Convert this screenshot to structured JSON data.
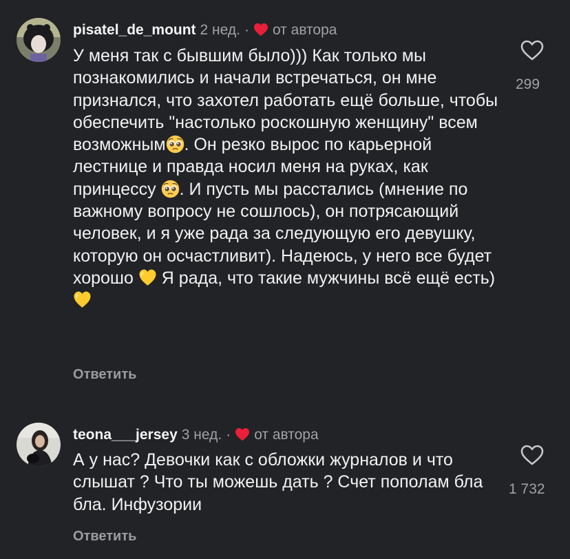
{
  "comments": [
    {
      "username": "pisatel_de_mount",
      "time": "2 нед.",
      "separator": "·",
      "author_label": "от автора",
      "text_parts": [
        "У меня так с бывшим было))) Как только мы познакомились и начали встречаться, он мне признался, что захотел работать ещё больше, чтобы обеспечить \"настолько роскошную женщину\" всем возможным",
        ". Он резко вырос по карьерной лестнице и правда носил меня на руках, как принцессу",
        ". И пусть мы расстались (мнение по важному вопросу не сошлось), он потрясающий человек, и я уже рада за следующую его девушку, которую он осчастливит). Надеюсь, у него все будет хорошо",
        "Я рада, что такие мужчины всё ещё есть)"
      ],
      "emojis": [
        "pleading-face",
        "pleading-face",
        "yellow-heart",
        "yellow-heart"
      ],
      "reply_label": "Ответить",
      "like_count": "299"
    },
    {
      "username": "teona___jersey",
      "time": "3 нед.",
      "separator": "·",
      "author_label": "от автора",
      "text": "А у нас? Девочки как с обложки журналов и что слышат ? Что ты можешь дать ? Счет пополам бла бла. Инфузории",
      "reply_label": "Ответить",
      "like_count": "1 732"
    }
  ],
  "colors": {
    "background": "#212327",
    "author_heart": "#e8203a",
    "muted_text": "#a0a2a7"
  }
}
